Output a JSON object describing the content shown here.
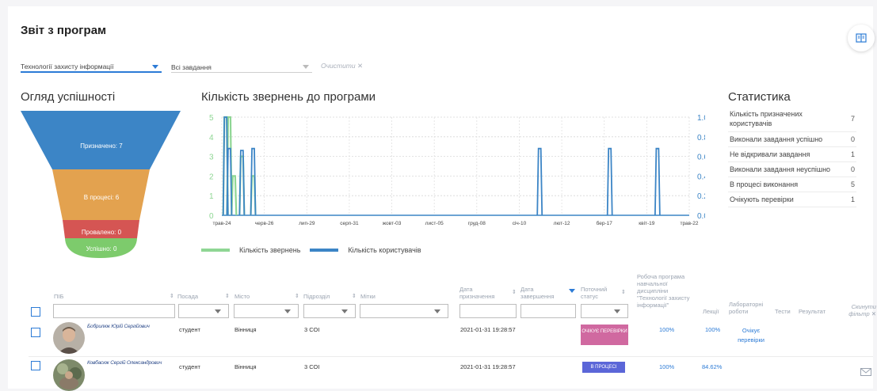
{
  "header": {
    "title": "Звіт з програм"
  },
  "filters": {
    "program": "Технології захисту інформації",
    "tasks": "Всі завдання",
    "clear": "Очистити ✕"
  },
  "sections": {
    "funnel_title": "Огляд успішності",
    "chart_title": "Кількість звернень до програми",
    "stats_title": "Статистика"
  },
  "funnel": [
    {
      "label": "Призначено: 7",
      "value": 7,
      "color": "#3c85c6"
    },
    {
      "label": "В процесі: 6",
      "value": 6,
      "color": "#e3a24f"
    },
    {
      "label": "Провалено: 0",
      "value": 0,
      "color": "#d55553"
    },
    {
      "label": "Успішно: 0",
      "value": 0,
      "color": "#7dcb6c"
    }
  ],
  "chart_data": {
    "type": "line",
    "x_ticks": [
      "трав-24",
      "черв-26",
      "лип-29",
      "серп-31",
      "жовт-03",
      "лист-05",
      "груд-08",
      "січ-10",
      "лют-12",
      "бер-17",
      "квіт-19",
      "трав-22"
    ],
    "y_left": {
      "ticks": [
        "0",
        "1",
        "2",
        "3",
        "4",
        "5"
      ],
      "range": [
        0,
        5
      ]
    },
    "y_right": {
      "ticks": [
        "0.0",
        "0.2",
        "0.4",
        "0.6",
        "0.8",
        "1.0"
      ],
      "range": [
        0,
        1
      ]
    },
    "grid": true,
    "series": [
      {
        "name": "Кількість звернень",
        "color": "#8fd694",
        "spikes": [
          {
            "x_frac": 0.008,
            "value": 5
          },
          {
            "x_frac": 0.016,
            "value": 5
          },
          {
            "x_frac": 0.026,
            "value": 2
          },
          {
            "x_frac": 0.043,
            "value": 3
          },
          {
            "x_frac": 0.067,
            "value": 2
          }
        ]
      },
      {
        "name": "Кількість користувачів",
        "color": "#3c85c6",
        "spikes": [
          {
            "x_frac": 0.008,
            "value": 5
          },
          {
            "x_frac": 0.016,
            "value": 3.4
          },
          {
            "x_frac": 0.043,
            "value": 3.3
          },
          {
            "x_frac": 0.067,
            "value": 3.4
          },
          {
            "x_frac": 0.68,
            "value": 3.4
          },
          {
            "x_frac": 0.83,
            "value": 3.4
          },
          {
            "x_frac": 0.932,
            "value": 3.4
          }
        ]
      }
    ],
    "legend_placement": "bottom"
  },
  "stats": [
    {
      "label": "Кількість призначених користувачів",
      "value": "7"
    },
    {
      "label": "Виконали завдання успішно",
      "value": "0"
    },
    {
      "label": "Не відкривали завдання",
      "value": "1"
    },
    {
      "label": "Виконали завдання неуспішно",
      "value": "0"
    },
    {
      "label": "В процесі виконання",
      "value": "5"
    },
    {
      "label": "Очікують перевірки",
      "value": "1"
    }
  ],
  "table": {
    "headers": {
      "pib": "ПІБ",
      "position": "Посада",
      "city": "Місто",
      "department": "Підрозділ",
      "tags": "Мітки",
      "date_assigned": "Дата призначення",
      "date_completed": "Дата завершення",
      "current_status": "Поточний статус",
      "work_program": "Робоча програма навчальної дисципліни \"Технології захисту інформації\"",
      "lectures": "Лекції",
      "labs": "Лабораторні роботи",
      "tests": "Тести",
      "result": "Результат",
      "reset_filter": "Скинути фільтр ✕"
    },
    "rows": [
      {
        "name": "Бобрилюк Юрій Сергійович",
        "position": "студент",
        "city": "Вінниця",
        "department": "3 СОІ",
        "date_assigned": "2021-01-31 19:28:57",
        "status": "ОЧІКУЄ ПЕРЕВІРКИ",
        "status_color": "#d069a0",
        "program_pct": "100%",
        "lectures_pct": "100%",
        "labs": "Очікує перевірки"
      },
      {
        "name": "Ковбасюк Сергій Олександрович",
        "position": "студент",
        "city": "Вінниця",
        "department": "3 СОІ",
        "date_assigned": "2021-01-31 19:28:57",
        "status": "В ПРОЦЕСІ",
        "status_color": "#5b66d8",
        "program_pct": "100%",
        "lectures_pct": "84.62%",
        "labs": ""
      }
    ]
  }
}
